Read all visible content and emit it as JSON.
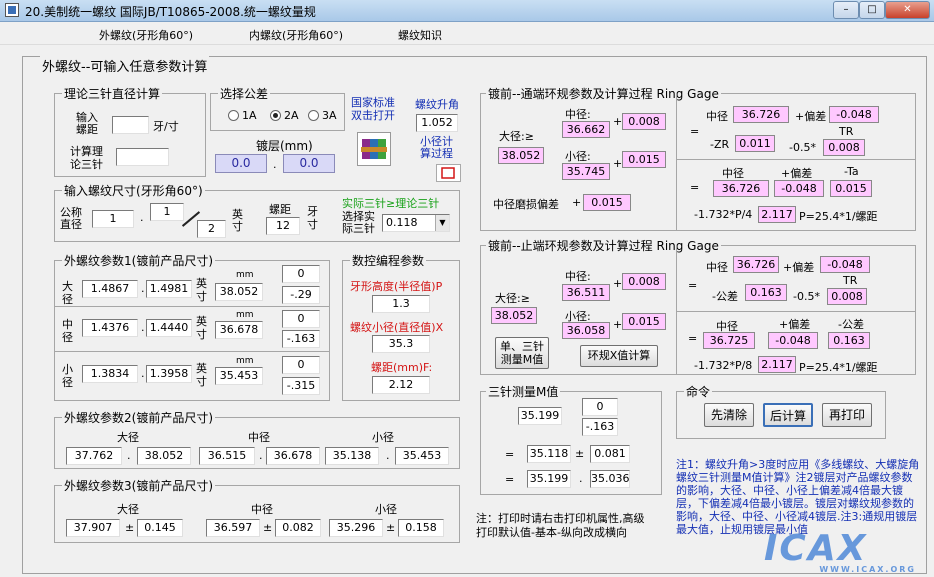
{
  "title": "20.美制统一螺纹 国际JB/T10865-2008.统一螺纹量规",
  "menu": [
    "外螺纹(牙形角60°)",
    "内螺纹(牙形角60°)",
    "螺纹知识"
  ],
  "panel_title": "外螺纹--可输入任意参数计算",
  "theory": {
    "title": "理论三针直径计算",
    "input_label": "输入\n螺距",
    "unit": "牙/寸",
    "calc_label": "计算理\n论三针",
    "input_value": "",
    "calc_value": ""
  },
  "tolerance": {
    "title": "选择公差",
    "options": [
      "1A",
      "2A",
      "3A"
    ],
    "selected": "2A",
    "plating_label": "镀层(mm)",
    "plating_a": "0.0",
    "plating_sep": ".",
    "plating_b": "0.0"
  },
  "standard_link": "国家标准\n双击打开",
  "lead_angle": {
    "label": "螺纹升角",
    "value": "1.052"
  },
  "small_calc": "小径计\n算过程",
  "input_size": {
    "title": "输入螺纹尺寸(牙形角60°)",
    "nominal_label": "公称\n直径",
    "whole": "1",
    "num": "1",
    "den": "2",
    "sep": ".",
    "inch": "英\n寸",
    "pitch_label": "螺距",
    "pitch_value": "12",
    "pitch_unit": "牙\n寸",
    "actual_label": "实际三针≥理论三针",
    "select_label": "选择实\n际三针",
    "select_value": "0.118"
  },
  "params1": {
    "title": "外螺纹参数1(镀前产品尺寸)",
    "rows": [
      {
        "label": "大\n径",
        "a": "1.4867",
        "b": "1.4981",
        "inch": "英\n寸",
        "mm_label": "mm",
        "mm": "38.052",
        "up": "0",
        "down": "-.29"
      },
      {
        "label": "中\n径",
        "a": "1.4376",
        "b": "1.4440",
        "inch": "英\n寸",
        "mm_label": "mm",
        "mm": "36.678",
        "up": "0",
        "down": "-.163"
      },
      {
        "label": "小\n径",
        "a": "1.3834",
        "b": "1.3958",
        "inch": "英\n寸",
        "mm_label": "mm",
        "mm": "35.453",
        "up": "0",
        "down": "-.315"
      }
    ],
    "sep": "."
  },
  "cnc": {
    "title": "数控编程参数",
    "height_label": "牙形高度(半径值)P",
    "height_value": "1.3",
    "minor_label": "螺纹小径(直径值)X",
    "minor_value": "35.3",
    "pitch_label": "螺距(mm)F:",
    "pitch_value": "2.12"
  },
  "params2": {
    "title": "外螺纹参数2(镀前产品尺寸)",
    "headers": [
      "大径",
      "中径",
      "小径"
    ],
    "values": [
      "37.762",
      "38.052",
      "36.515",
      "36.678",
      "35.138",
      "35.453"
    ],
    "sep": "."
  },
  "params3": {
    "title": "外螺纹参数3(镀前产品尺寸)",
    "headers": [
      "大径",
      "中径",
      "小径"
    ],
    "values": [
      "37.907",
      "0.145",
      "36.597",
      "0.082",
      "35.296",
      "0.158"
    ],
    "pm": "±"
  },
  "go_ring": {
    "title": "镀前--通端环规参数及计算过程 Ring Gage",
    "major_label": "大径:≥",
    "major_value": "38.052",
    "mid_label": "中径:",
    "mid_value": "36.662",
    "mid_plus": "0.008",
    "minor_label": "小径:",
    "minor_value": "35.745",
    "minor_plus": "0.015",
    "wear_label": "中径磨损偏差",
    "wear_value": "0.015",
    "plus": "+",
    "r_mid_label": "中径",
    "r_mid": "36.726",
    "r_dev_label": "+偏差",
    "r_dev": "-0.048",
    "eq": "=",
    "zr_label": "-ZR",
    "zr": "0.011",
    "coef": "-0.5*",
    "tr_label": "TR",
    "tr": "0.008",
    "b_mid_label": "中径",
    "b_dev_label": "+偏差",
    "b_ta_label": "-Ta",
    "b_mid": "36.726",
    "b_dev": "-0.048",
    "b_ta": "0.015",
    "formula_left": "-1.732*P/4",
    "formula_val": "2.117",
    "formula_right": "P=25.4*1/螺距"
  },
  "nogo_ring": {
    "title": "镀前--止端环规参数及计算过程 Ring Gage",
    "major_label": "大径:≥",
    "major_value": "38.052",
    "mid_label": "中径:",
    "mid_value": "36.511",
    "mid_plus": "0.008",
    "minor_label": "小径:",
    "minor_value": "36.058",
    "minor_plus": "0.015",
    "btn_single": "单、三针\n测量M值",
    "btn_ring": "环规X值计算",
    "plus": "+",
    "r_mid_label": "中径",
    "r_mid": "36.726",
    "r_dev_label": "+偏差",
    "r_dev": "-0.048",
    "eq": "=",
    "tol_label": "-公差",
    "tol": "0.163",
    "coef": "-0.5*",
    "tr_label": "TR",
    "tr": "0.008",
    "b_mid_label": "中径",
    "b_dev_label": "+偏差",
    "b_tol_label": "-公差",
    "b_mid": "36.725",
    "b_dev": "-0.048",
    "b_tol": "0.163",
    "formula_left": "-1.732*P/8",
    "formula_val": "2.117",
    "formula_right": "P=25.4*1/螺距"
  },
  "three_wire": {
    "title": "三针测量M值",
    "m": "35.199",
    "up": "0",
    "down": "-.163",
    "eq": "=",
    "v1": "35.118",
    "pm": "±",
    "v2": "0.081",
    "v3": "35.199",
    "sep": ".",
    "v4": "35.036"
  },
  "commands": {
    "title": "命令",
    "clear": "先清除",
    "calc": "后计算",
    "print": "再打印"
  },
  "note_print": "注：打印时请右击打印机属性,高级\n打印默认值-基本-纵向改成横向",
  "note_main": "注1：螺纹升角>3度时应用《多线螺纹、大螺旋角螺纹三针测量M值计算》注2镀层对产品螺纹参数的影响，大径、中径、小径上偏差减4倍最大镀层，下偏差减4倍最小镀层。镀层对螺纹规参数的影响，大径、中径、小径减4镀层.注3:通规用镀层最大值，止规用镀层最小值",
  "watermark": "ICAX",
  "watermark_url": "WWW.ICAX.ORG"
}
